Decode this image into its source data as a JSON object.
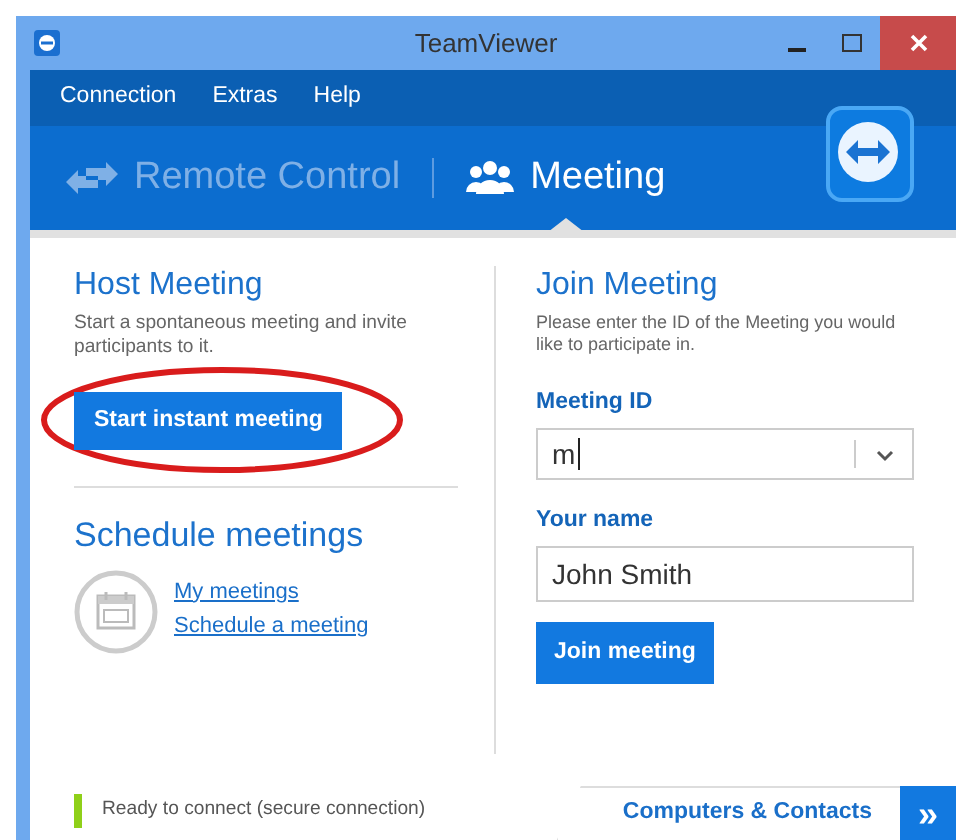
{
  "window": {
    "title": "TeamViewer"
  },
  "menu": [
    "Connection",
    "Extras",
    "Help"
  ],
  "tabs": [
    {
      "label": "Remote Control",
      "kind": "arrows",
      "selected": false
    },
    {
      "label": "Meeting",
      "kind": "people",
      "selected": true
    }
  ],
  "host": {
    "title": "Host Meeting",
    "description": "Start a spontaneous meeting and invite participants to it.",
    "button": "Start instant meeting",
    "highlighted": true
  },
  "schedule": {
    "title": "Schedule meetings",
    "links": [
      "My meetings",
      "Schedule a meeting"
    ]
  },
  "join": {
    "title": "Join Meeting",
    "description": "Please enter the ID of the Meeting you would like to participate in.",
    "meeting_id_label": "Meeting ID",
    "meeting_id": "m",
    "name_label": "Your name",
    "name": "John Smith",
    "button": "Join meeting"
  },
  "status": {
    "text": "Ready to connect (secure connection)",
    "ready": true
  },
  "bottom_tab": {
    "label": "Computers & Contacts",
    "expand": "»"
  }
}
